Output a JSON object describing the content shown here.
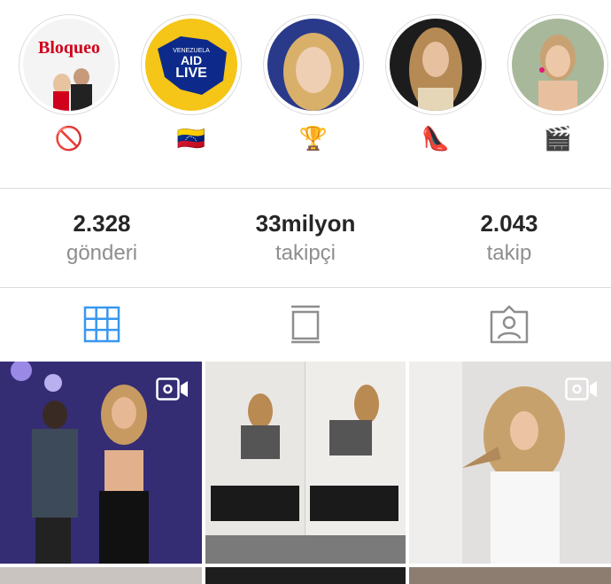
{
  "highlights": [
    {
      "title_text": "Bloqueo",
      "emoji": "🚫",
      "colors": {
        "bg": "#f4f4f4"
      }
    },
    {
      "title_text": "VENEZUELA AID LIVE",
      "emoji": "🇻🇪",
      "colors": {
        "bg": "#f5c518"
      }
    },
    {
      "title_text": "",
      "emoji": "🏆",
      "colors": {
        "bg": "#2a3a8a"
      }
    },
    {
      "title_text": "",
      "emoji": "👠",
      "colors": {
        "bg": "#1c1c1c"
      }
    },
    {
      "title_text": "",
      "emoji": "🎬",
      "colors": {
        "bg": "#a8b89a"
      }
    }
  ],
  "stats": {
    "posts": {
      "value": "2.328",
      "label": "gönderi"
    },
    "followers": {
      "value": "33milyon",
      "label": "takipçi"
    },
    "following": {
      "value": "2.043",
      "label": "takip"
    }
  },
  "tabs": [
    {
      "icon": "grid-icon",
      "active": true
    },
    {
      "icon": "igtv-icon",
      "active": false
    },
    {
      "icon": "tagged-icon",
      "active": false
    }
  ],
  "colors": {
    "active_tab": "#3897f0",
    "inactive_tab": "#8e8e8e",
    "divider": "#dbdbdb"
  },
  "posts": [
    {
      "type": "video"
    },
    {
      "type": "photo"
    },
    {
      "type": "video"
    }
  ]
}
